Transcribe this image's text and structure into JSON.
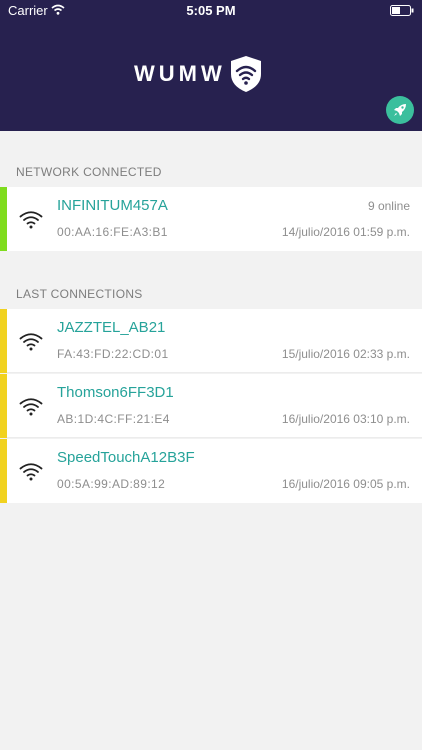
{
  "status_bar": {
    "carrier": "Carrier",
    "time": "5:05 PM"
  },
  "header": {
    "app_name": "WUMW",
    "rocket_icon": "rocket-icon"
  },
  "connected_section": {
    "label": "NETWORK CONNECTED",
    "network": {
      "name": "INFINITUM457A",
      "mac": "00:AA:16:FE:A3:B1",
      "date": "14/julio/2016 01:59 p.m.",
      "online": "9 online",
      "stripe_color": "#7fdc1e"
    }
  },
  "last_section": {
    "label": "LAST CONNECTIONS",
    "networks": [
      {
        "name": "JAZZTEL_AB21",
        "mac": "FA:43:FD:22:CD:01",
        "date": "15/julio/2016 02:33 p.m.",
        "stripe_color": "#f1d21f"
      },
      {
        "name": "Thomson6FF3D1",
        "mac": "AB:1D:4C:FF:21:E4",
        "date": "16/julio/2016 03:10 p.m.",
        "stripe_color": "#f1d21f"
      },
      {
        "name": "SpeedTouchA12B3F",
        "mac": "00:5A:99:AD:89:12",
        "date": "16/julio/2016 09:05 p.m.",
        "stripe_color": "#f1d21f"
      }
    ]
  },
  "colors": {
    "header_bg": "#27214f",
    "accent": "#3bbf9d",
    "network_name": "#26a39a"
  }
}
